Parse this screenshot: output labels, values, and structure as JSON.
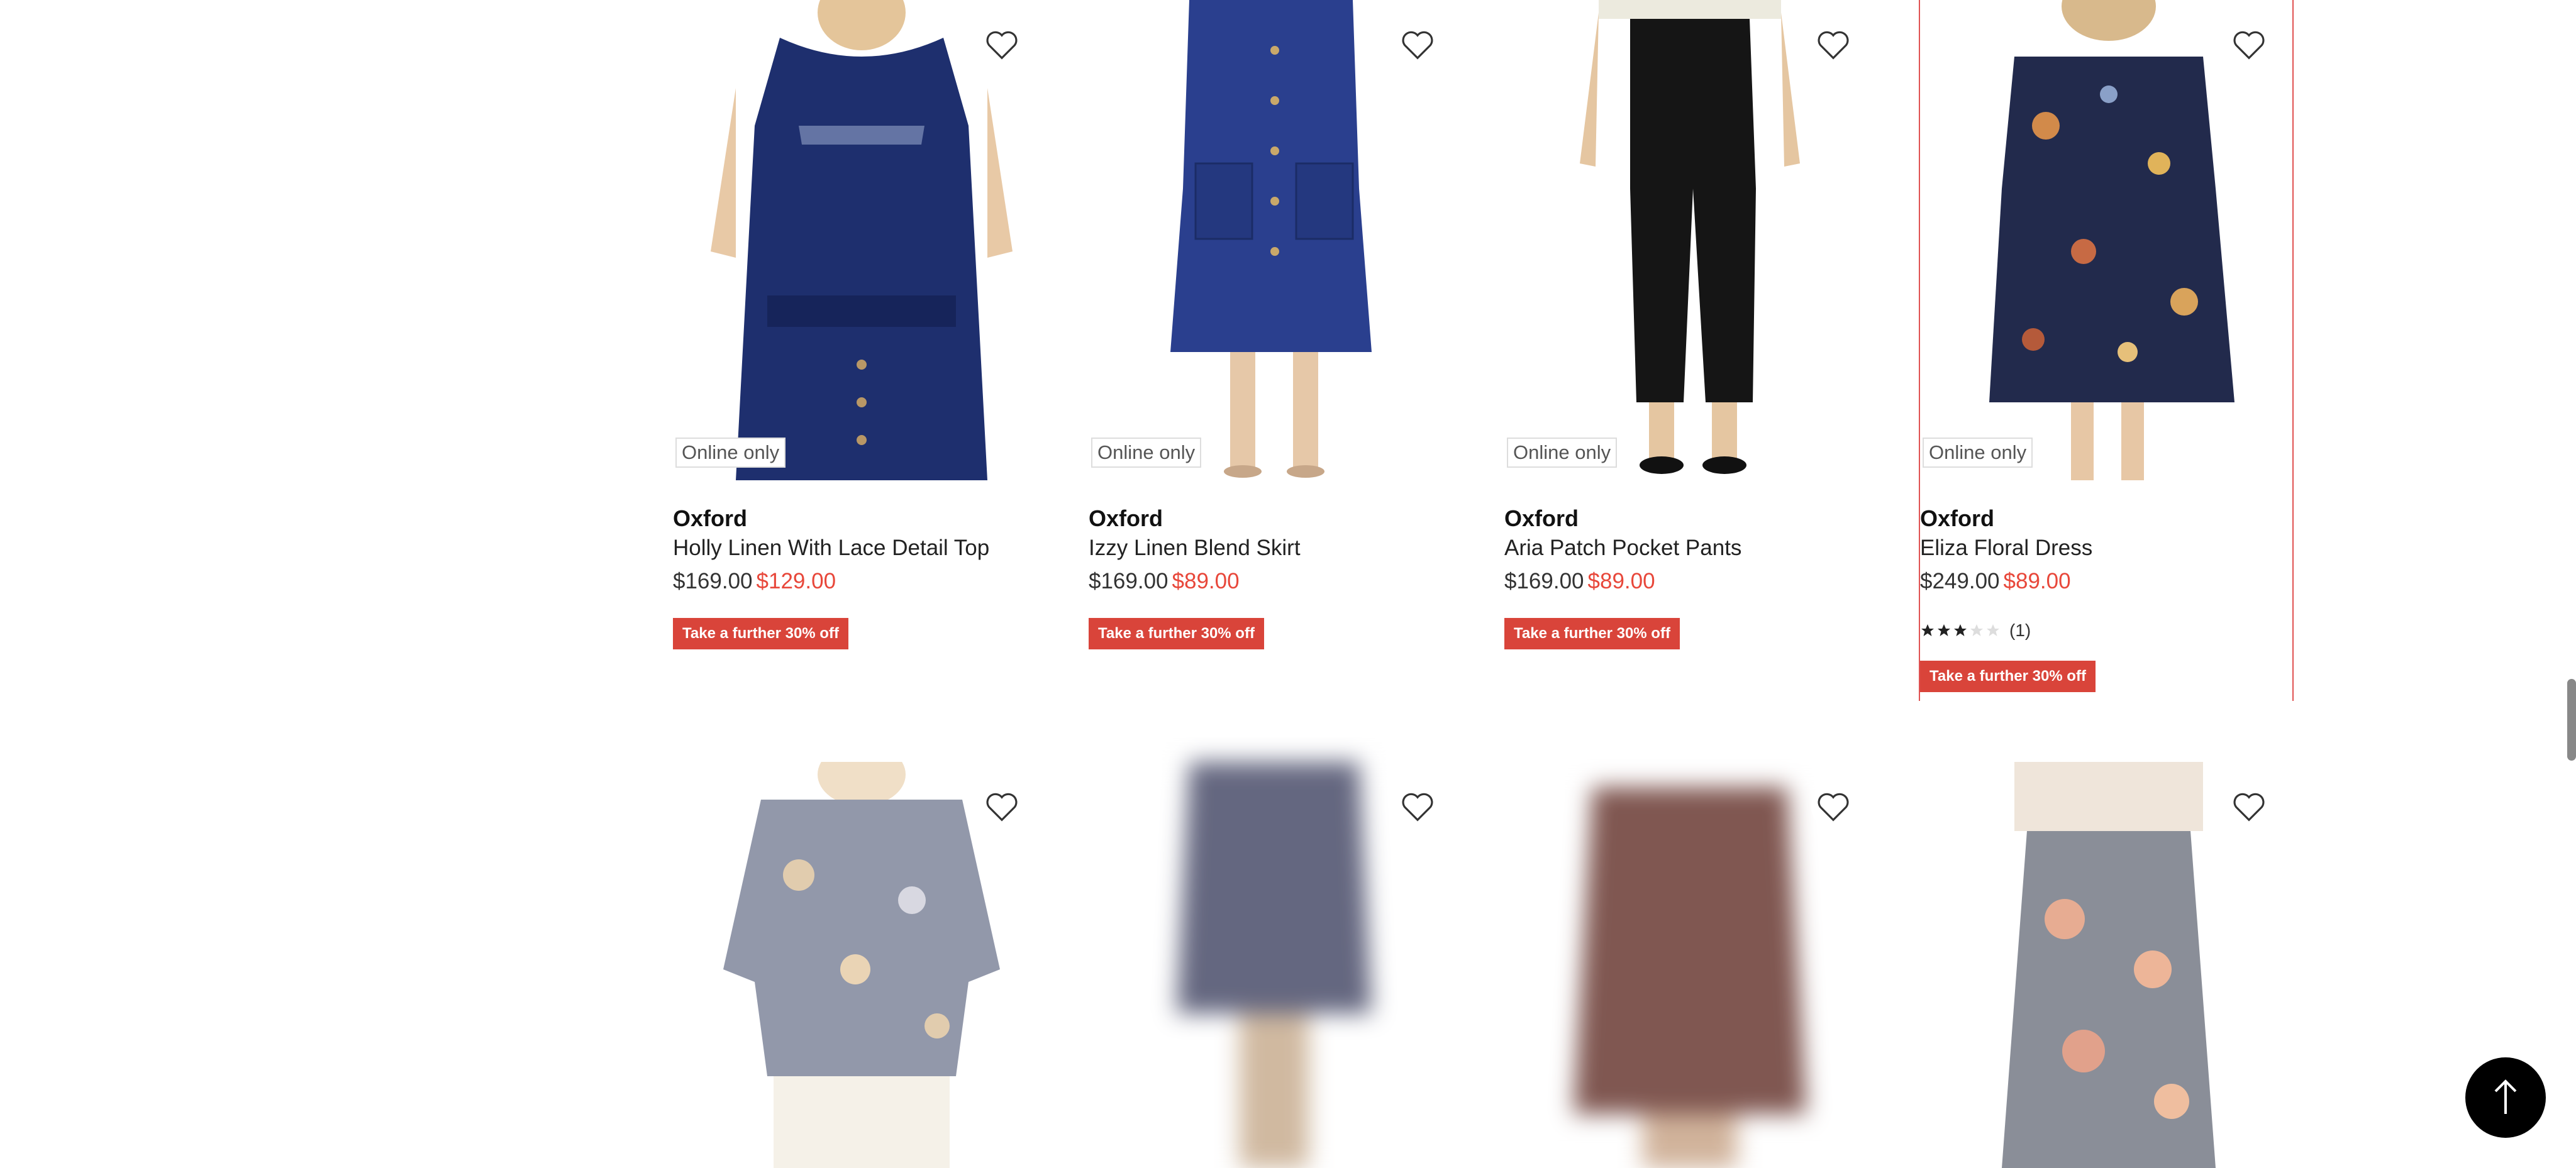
{
  "products": [
    {
      "online_badge": "Online only",
      "brand": "Oxford",
      "name": "Holly Linen With Lace Detail Top",
      "was_price": "$169.00",
      "now_price": "$129.00",
      "promo": "Take a further 30% off"
    },
    {
      "online_badge": "Online only",
      "brand": "Oxford",
      "name": "Izzy Linen Blend Skirt",
      "was_price": "$169.00",
      "now_price": "$89.00",
      "promo": "Take a further 30% off"
    },
    {
      "online_badge": "Online only",
      "brand": "Oxford",
      "name": "Aria Patch Pocket Pants",
      "was_price": "$169.00",
      "now_price": "$89.00",
      "promo": "Take a further 30% off"
    },
    {
      "online_badge": "Online only",
      "brand": "Oxford",
      "name": "Eliza Floral Dress",
      "was_price": "$249.00",
      "now_price": "$89.00",
      "rating_value": 3,
      "rating_max": 5,
      "rating_count": "(1)",
      "promo": "Take a further 30% off"
    }
  ],
  "icons": {
    "wishlist": "heart-outline-icon",
    "back_to_top": "arrow-up-icon",
    "rating": "star-icon"
  },
  "colors": {
    "promo_bg": "#d9443a",
    "sale_price": "#e8473a",
    "selected_border": "#e05252"
  }
}
